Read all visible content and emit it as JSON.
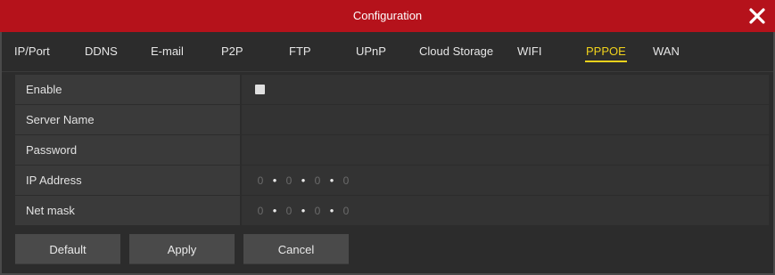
{
  "window": {
    "title": "Configuration"
  },
  "tabs": [
    {
      "label": "IP/Port"
    },
    {
      "label": "DDNS"
    },
    {
      "label": "E-mail"
    },
    {
      "label": "P2P"
    },
    {
      "label": "FTP"
    },
    {
      "label": "UPnP"
    },
    {
      "label": "Cloud Storage"
    },
    {
      "label": "WIFI"
    },
    {
      "label": "PPPOE",
      "active": true
    },
    {
      "label": "WAN"
    }
  ],
  "form": {
    "enable": {
      "label": "Enable",
      "checked": false
    },
    "server_name": {
      "label": "Server Name",
      "value": ""
    },
    "password": {
      "label": "Password",
      "value": ""
    },
    "ip_address": {
      "label": "IP Address",
      "octets": [
        "0",
        "0",
        "0",
        "0"
      ]
    },
    "net_mask": {
      "label": "Net mask",
      "octets": [
        "0",
        "0",
        "0",
        "0"
      ]
    }
  },
  "buttons": {
    "default_label": "Default",
    "apply_label": "Apply",
    "cancel_label": "Cancel"
  },
  "colors": {
    "titlebar": "#b5121b",
    "active_tab": "#f0d21c",
    "background": "#2c2c2c"
  }
}
